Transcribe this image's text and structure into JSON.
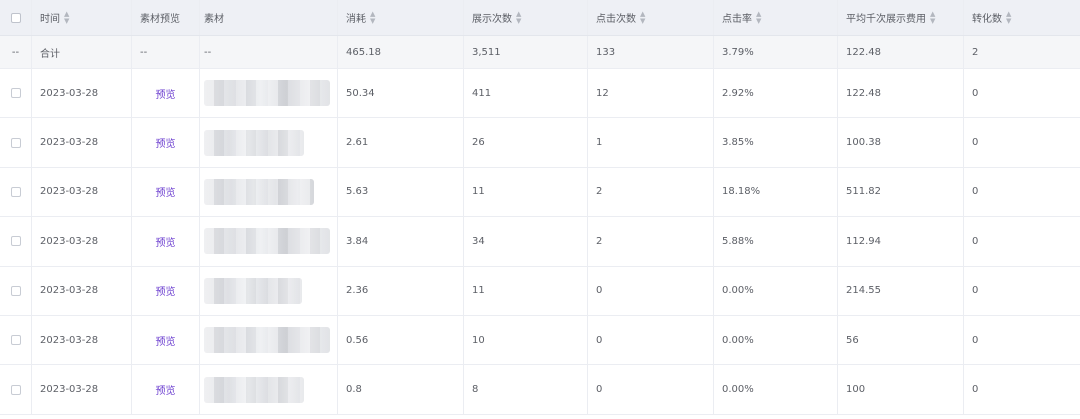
{
  "icons": {
    "sort": "sort-caret-icon",
    "checkbox": "checkbox-icon"
  },
  "colors": {
    "link": "#6a3ccf",
    "header_bg": "#eef0f5",
    "total_bg": "#f5f6f8"
  },
  "table": {
    "headers": {
      "time": "时间",
      "preview": "素材预览",
      "material": "素材",
      "cost": "消耗",
      "impressions": "展示次数",
      "clicks": "点击次数",
      "ctr": "点击率",
      "cpm": "平均千次展示费用",
      "conversions": "转化数"
    },
    "total": {
      "check": "--",
      "time": "合计",
      "preview": "--",
      "material": "--",
      "cost": "465.18",
      "impressions": "3,511",
      "clicks": "133",
      "ctr": "3.79%",
      "cpm": "122.48",
      "conversions": "2"
    },
    "rows": [
      {
        "time": "2023-03-28",
        "preview": "预览",
        "cost": "50.34",
        "impressions": "411",
        "clicks": "12",
        "ctr": "2.92%",
        "cpm": "122.48",
        "conversions": "0"
      },
      {
        "time": "2023-03-28",
        "preview": "预览",
        "cost": "2.61",
        "impressions": "26",
        "clicks": "1",
        "ctr": "3.85%",
        "cpm": "100.38",
        "conversions": "0"
      },
      {
        "time": "2023-03-28",
        "preview": "预览",
        "cost": "5.63",
        "impressions": "11",
        "clicks": "2",
        "ctr": "18.18%",
        "cpm": "511.82",
        "conversions": "0"
      },
      {
        "time": "2023-03-28",
        "preview": "预览",
        "cost": "3.84",
        "impressions": "34",
        "clicks": "2",
        "ctr": "5.88%",
        "cpm": "112.94",
        "conversions": "0"
      },
      {
        "time": "2023-03-28",
        "preview": "预览",
        "cost": "2.36",
        "impressions": "11",
        "clicks": "0",
        "ctr": "0.00%",
        "cpm": "214.55",
        "conversions": "0"
      },
      {
        "time": "2023-03-28",
        "preview": "预览",
        "cost": "0.56",
        "impressions": "10",
        "clicks": "0",
        "ctr": "0.00%",
        "cpm": "56",
        "conversions": "0"
      },
      {
        "time": "2023-03-28",
        "preview": "预览",
        "cost": "0.8",
        "impressions": "8",
        "clicks": "0",
        "ctr": "0.00%",
        "cpm": "100",
        "conversions": "0"
      }
    ]
  }
}
